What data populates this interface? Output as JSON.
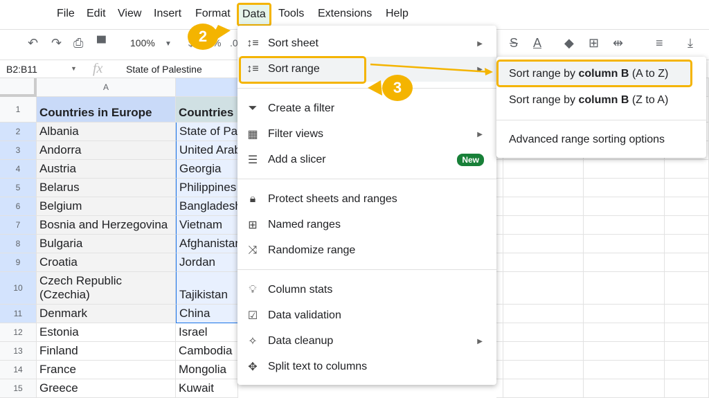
{
  "menubar": {
    "items": [
      "File",
      "Edit",
      "View",
      "Insert",
      "Format",
      "Data",
      "Tools",
      "Extensions",
      "Help"
    ]
  },
  "toolbar": {
    "zoom": "100%",
    "currency": "$",
    "percent": "%",
    "decimal": ".0"
  },
  "formula_bar": {
    "name_box": "B2:B11",
    "fx": "fx",
    "value": "State of Palestine"
  },
  "columns": [
    "A",
    ""
  ],
  "rows": [
    {
      "n": "1",
      "a": "Countries in Europe",
      "b": "Countries"
    },
    {
      "n": "2",
      "a": "Albania",
      "b": "State of Pa"
    },
    {
      "n": "3",
      "a": "Andorra",
      "b": "United Arab"
    },
    {
      "n": "4",
      "a": "Austria",
      "b": "Georgia"
    },
    {
      "n": "5",
      "a": "Belarus",
      "b": "Philippines"
    },
    {
      "n": "6",
      "a": "Belgium",
      "b": "Bangladesh"
    },
    {
      "n": "7",
      "a": "Bosnia and Herzegovina",
      "b": "Vietnam"
    },
    {
      "n": "8",
      "a": "Bulgaria",
      "b": "Afghanistan"
    },
    {
      "n": "9",
      "a": "Croatia",
      "b": "Jordan"
    },
    {
      "n": "10",
      "a": "Czech Republic\n(Czechia)",
      "b": "Tajikistan"
    },
    {
      "n": "11",
      "a": "Denmark",
      "b": "China"
    },
    {
      "n": "12",
      "a": "Estonia",
      "b": "Israel"
    },
    {
      "n": "13",
      "a": "Finland",
      "b": "Cambodia"
    },
    {
      "n": "14",
      "a": "France",
      "b": "Mongolia"
    },
    {
      "n": "15",
      "a": "Greece",
      "b": "Kuwait"
    }
  ],
  "data_menu": {
    "items": [
      {
        "label": "Sort sheet",
        "icon": "sort-icon",
        "submenu": true
      },
      {
        "label": "Sort range",
        "icon": "sort-icon",
        "submenu": true
      },
      {
        "label": "Create a filter",
        "icon": "filter-icon"
      },
      {
        "label": "Filter views",
        "icon": "filter-views-icon",
        "submenu": true
      },
      {
        "label": "Add a slicer",
        "icon": "slicer-icon",
        "badge": "New"
      },
      {
        "label": "Protect sheets and ranges",
        "icon": "lock-icon"
      },
      {
        "label": "Named ranges",
        "icon": "named-ranges-icon"
      },
      {
        "label": "Randomize range",
        "icon": "shuffle-icon"
      },
      {
        "label": "Column stats",
        "icon": "lightbulb-icon"
      },
      {
        "label": "Data validation",
        "icon": "validation-icon"
      },
      {
        "label": "Data cleanup",
        "icon": "magic-wand-icon",
        "submenu": true
      },
      {
        "label": "Split text to columns",
        "icon": "split-icon"
      }
    ]
  },
  "submenu": {
    "az_pre": "Sort range by ",
    "az_bold": "column B",
    "az_post": " (A to Z)",
    "za_pre": "Sort range by ",
    "za_bold": "column B",
    "za_post": " (Z to A)",
    "advanced": "Advanced range sorting options"
  },
  "callouts": [
    "2",
    "3"
  ],
  "colors": {
    "highlight": "#f4b400",
    "header_blue": "#c9daf8",
    "selection": "#e8f0fe",
    "badge": "#188038"
  }
}
